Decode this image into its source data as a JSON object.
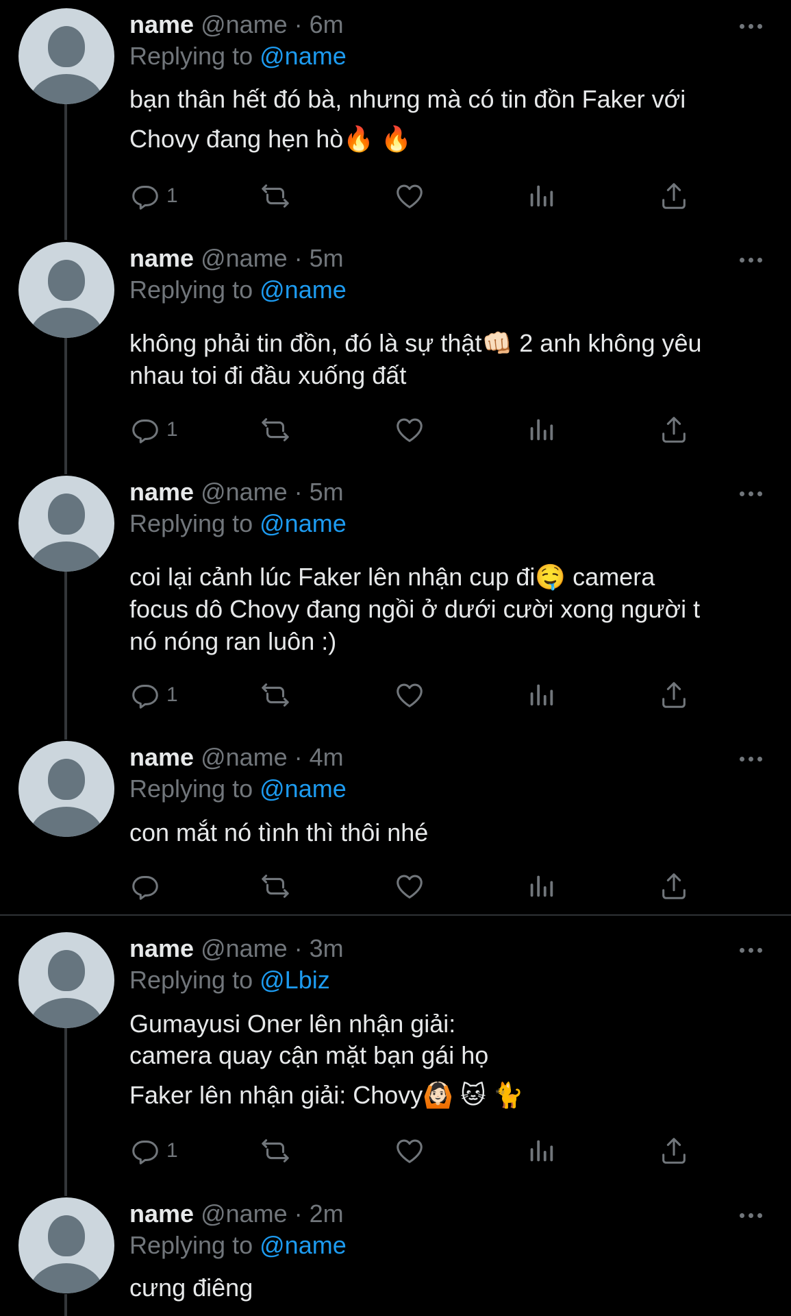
{
  "tweets": [
    {
      "name": "name",
      "meta": "@name · 6m",
      "replying_prefix": "Replying to",
      "replying_handle": "@name",
      "lines": [
        "bạn thân hết đó bà, nhưng mà có tin đồn Faker với",
        "Chovy đang hẹn hò🔥 🔥"
      ],
      "reply_count": "1"
    },
    {
      "name": "name",
      "meta": "@name · 5m",
      "replying_prefix": "Replying to",
      "replying_handle": "@name",
      "lines": [
        "không phải tin đồn, đó là sự thật👊🏻 2 anh không yêu",
        "nhau toi đi đầu xuống đất"
      ],
      "reply_count": "1"
    },
    {
      "name": "name",
      "meta": "@name · 5m",
      "replying_prefix": "Replying to",
      "replying_handle": "@name",
      "lines": [
        "coi lại cảnh lúc Faker lên nhận cup đi🤤 camera",
        "focus dô Chovy đang ngồi ở dưới cười xong người t",
        "nó nóng ran luôn :)"
      ],
      "reply_count": "1"
    },
    {
      "name": "name",
      "meta": "@name · 4m",
      "replying_prefix": "Replying to",
      "replying_handle": "@name",
      "lines": [
        "con mắt nó tình thì thôi nhé"
      ],
      "reply_count": ""
    },
    {
      "name": "name",
      "meta": "@name · 3m",
      "replying_prefix": "Replying to",
      "replying_handle": "@Lbiz",
      "lines": [
        "Gumayusi Oner lên nhận giải:",
        "camera quay cận mặt bạn gái họ",
        "Faker lên nhận giải: Chovy🙆🏻 🐱 🐈"
      ],
      "reply_count": "1"
    },
    {
      "name": "name",
      "meta": "@name · 2m",
      "replying_prefix": "Replying to",
      "replying_handle": "@name",
      "lines": [
        "cưng điêng"
      ],
      "reply_count": ""
    }
  ],
  "icons": {
    "reply": "reply-icon",
    "retweet": "retweet-icon",
    "like": "heart-icon",
    "views": "views-icon",
    "share": "share-icon",
    "more": "more-icon"
  },
  "colors": {
    "background": "#000000",
    "text": "#e7e9ea",
    "muted": "#71767b",
    "link": "#1d9bf0",
    "avatar": "#ccd6dd"
  }
}
